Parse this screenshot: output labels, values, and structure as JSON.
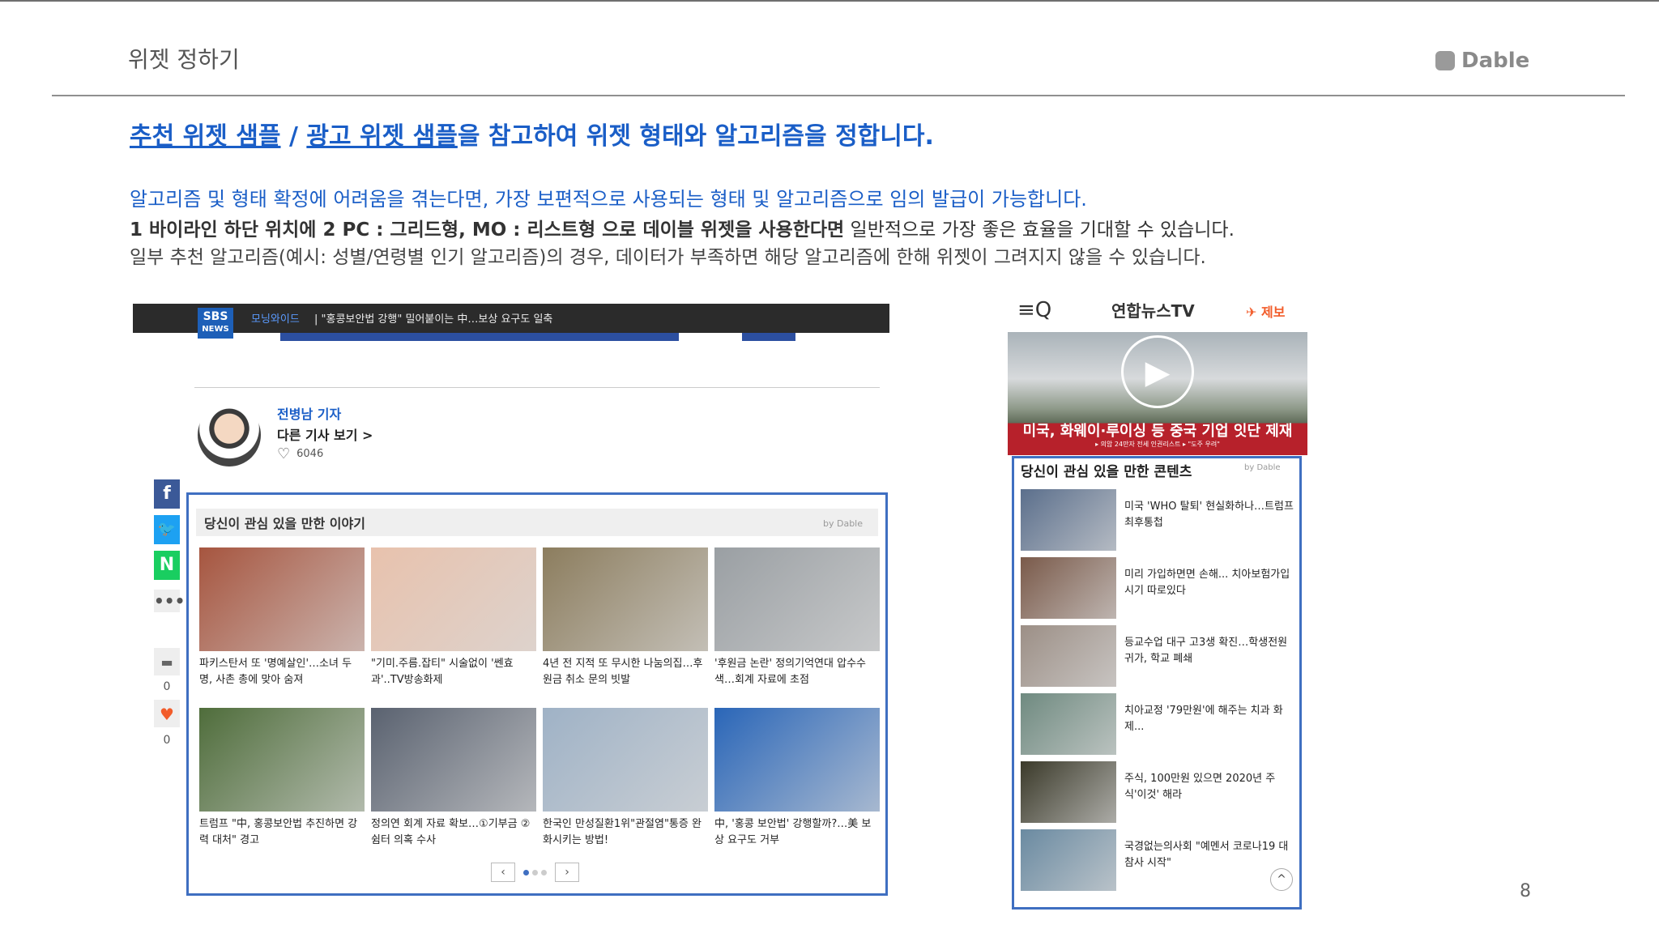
{
  "slide": {
    "title": "위젯 정하기",
    "brand": "Dable",
    "page_number": "8"
  },
  "headline": {
    "link1": "추천 위젯 샘플",
    "sep": " / ",
    "link2": "광고 위젯 샘플",
    "rest": "을 참고하여 위젯 형태와 알고리즘을 정합니다."
  },
  "body": {
    "line1": "알고리즘 및 형태 확정에 어려움을 겪는다면, 가장 보편적으로 사용되는 형태 및 알고리즘으로 임의 발급이 가능합니다.",
    "line2_bold": "1 바이라인 하단 위치에 2 PC : 그리드형, MO : 리스트형 으로 데이블 위젯을 사용한다면",
    "line2_rest": " 일반적으로 가장 좋은 효율을 기대할 수 있습니다.",
    "line3": "일부 추천 알고리즘(예시: 성별/연령별 인기 알고리즘)의 경우, 데이터가 부족하면 해당 알고리즘에 한해 위젯이 그려지지 않을 수 있습니다."
  },
  "pc": {
    "logo_top": "SBS",
    "logo_bottom": "NEWS",
    "section": "모닝와이드",
    "bar_text": "|   \"홍콩보안법 강행\" 밀어붙이는 中…보상 요구도 일축",
    "reporter": "전병남 기자",
    "more_articles": "다른 기사 보기 >",
    "likes": "6046",
    "comment_count": "0",
    "heart_count": "0",
    "widget_title": "당신이 관심 있을 만한 이야기",
    "widget_by": "by Dable",
    "cards": [
      {
        "caption": "파키스탄서 또 '명예살인'…소녀 두 명, 사촌 총에 맞아 숨져",
        "color": "#a6553f"
      },
      {
        "caption": "\"기미.주름.잡티\" 시술없이 '쎈효과'..TV방송화제",
        "color": "#e8c2ad"
      },
      {
        "caption": "4년 전 지적 또 무시한 나눔의집…후원금 취소 문의 빗발",
        "color": "#8c7d5e"
      },
      {
        "caption": "'후원금 논란' 정의기억연대 압수수색…회계 자료에 초점",
        "color": "#9a9fa3"
      },
      {
        "caption": "트럼프 \"中, 홍콩보안법 추진하면 강력 대처\" 경고",
        "color": "#4f6d3b"
      },
      {
        "caption": "정의연 회계 자료 확보…①기부금 ②쉼터 의혹 수사",
        "color": "#5a6270"
      },
      {
        "caption": "한국인 만성질환1위\"관절염\"통증 완화시키는 방법!",
        "color": "#9fb2c6"
      },
      {
        "caption": "中, '홍콩 보안법' 강행할까?…美 보상 요구도 거부",
        "color": "#2a66b8"
      }
    ]
  },
  "mo": {
    "menu_icon": "≡Q",
    "logo": "연합뉴스TV",
    "tip": "제보",
    "video_title": "미국, 화웨이·루이싱 등 중국 기업 잇단 제재",
    "video_ticker": "▸ 의암 24만자 전세 인권리스트 ▸ \"도주 우려\"",
    "widget_title": "당신이 관심 있을 만한 콘텐츠",
    "widget_by": "by Dable",
    "items": [
      {
        "caption": "미국 'WHO 탈퇴' 현실화하나…트럼프 최후통첩",
        "color": "#5b6f8c"
      },
      {
        "caption": "미리 가입하면면 손해... 치아보험가입시기 따로있다",
        "color": "#7a5a4a"
      },
      {
        "caption": "등교수업 대구 고3생 확진…학생전원 귀가, 학교 폐쇄",
        "color": "#9c8f86"
      },
      {
        "caption": "치아교정 '79만원'에 해주는 치과 화제...",
        "color": "#6f8a80"
      },
      {
        "caption": "주식, 100만원 있으면 2020년 주식'이것' 해라",
        "color": "#3b3a2a"
      },
      {
        "caption": "국경없는의사회 \"예멘서 코로나19 대참사 시작\"",
        "color": "#6a8aa1"
      }
    ]
  }
}
